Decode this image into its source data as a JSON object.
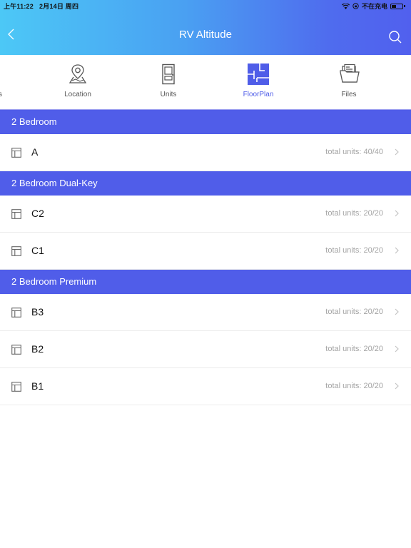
{
  "status_bar": {
    "time": "上午11:22",
    "date": "2月14日 周四",
    "charging_text": "不在充电",
    "wifi_icon": "wifi-icon",
    "lock_icon": "orientation-lock-icon",
    "battery_icon": "battery-icon"
  },
  "header": {
    "title": "RV Altitude",
    "back_icon": "chevron-left-icon",
    "search_icon": "search-icon",
    "gradient_start": "#4cc8f6",
    "gradient_end": "#5160ee"
  },
  "tabs": {
    "partial_label": "s",
    "items": [
      {
        "label": "Location",
        "icon": "map-pin-icon",
        "active": false
      },
      {
        "label": "Units",
        "icon": "door-icon",
        "active": false
      },
      {
        "label": "FloorPlan",
        "icon": "floorplan-icon",
        "active": true
      },
      {
        "label": "Files",
        "icon": "folder-icon",
        "active": false
      }
    ]
  },
  "colors": {
    "accent": "#4f5de8",
    "section_bg": "#505de9",
    "muted_text": "#a4a4a4"
  },
  "sections": [
    {
      "title": "2 Bedroom",
      "rows": [
        {
          "name": "A",
          "units": "total units: 40/40"
        }
      ]
    },
    {
      "title": "2 Bedroom Dual-Key",
      "rows": [
        {
          "name": "C2",
          "units": "total units: 20/20"
        },
        {
          "name": "C1",
          "units": "total units: 20/20"
        }
      ]
    },
    {
      "title": "2 Bedroom Premium",
      "rows": [
        {
          "name": "B3",
          "units": "total units: 20/20"
        },
        {
          "name": "B2",
          "units": "total units: 20/20"
        },
        {
          "name": "B1",
          "units": "total units: 20/20"
        }
      ]
    }
  ]
}
